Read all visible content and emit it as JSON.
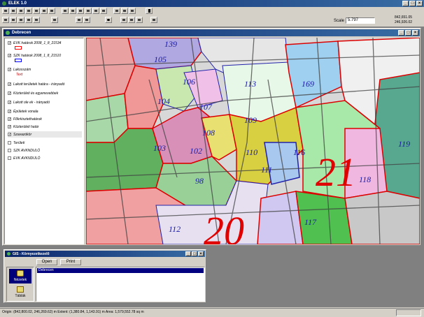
{
  "app": {
    "title": "ELEK 1.0"
  },
  "toolbar": {
    "scale_label": "Scale 1:",
    "scale_value": "5.797",
    "coords": [
      "842,651.05",
      "246,926.02"
    ]
  },
  "map_window": {
    "title": "Debrecen",
    "layers": [
      {
        "label": "EVK határok 2008_1_8_21534",
        "checked": true,
        "swatch": "#ff0000"
      },
      {
        "label": "SZK határok 2008_1_8_21510",
        "checked": true,
        "swatch": "#0000ff"
      },
      {
        "label": "Lakosszám",
        "checked": true,
        "note": "Text"
      },
      {
        "label": "Lakott területek határa - irányadó",
        "checked": true
      },
      {
        "label": "Közterületi és egyenexebbek",
        "checked": true
      },
      {
        "label": "Lakott ole ek - irányadó",
        "checked": true
      },
      {
        "label": "Épületek vonala",
        "checked": true
      },
      {
        "label": "Főkrkisztethatárok",
        "checked": true
      },
      {
        "label": "Közterületi határ",
        "checked": true
      },
      {
        "label": "Szavazókör",
        "checked": true
      },
      {
        "label": "Területi",
        "checked": false
      },
      {
        "label": "SZK AVKNDULÓ",
        "checked": false
      },
      {
        "label": "EVK AVKNDULÓ",
        "checked": false
      }
    ],
    "district_labels": [
      "139",
      "105",
      "106",
      "104",
      "107",
      "113",
      "169",
      "109",
      "108",
      "103",
      "102",
      "110",
      "111",
      "116",
      "98",
      "21",
      "118",
      "119",
      "112",
      "20",
      "117"
    ]
  },
  "gis_window": {
    "title": "GIS - Környezetkezelő",
    "open_label": "Open",
    "print_label": "Print",
    "tabs": [
      {
        "label": "Nézetek"
      },
      {
        "label": "Táblák"
      }
    ],
    "list_items": [
      "Debrecen"
    ]
  },
  "status": {
    "text": "Origin: (842,800.02, 246,269.62) m  Extent: (1,380.84, 1,143.91) m  Area: 1,579,552.78 sq m"
  }
}
